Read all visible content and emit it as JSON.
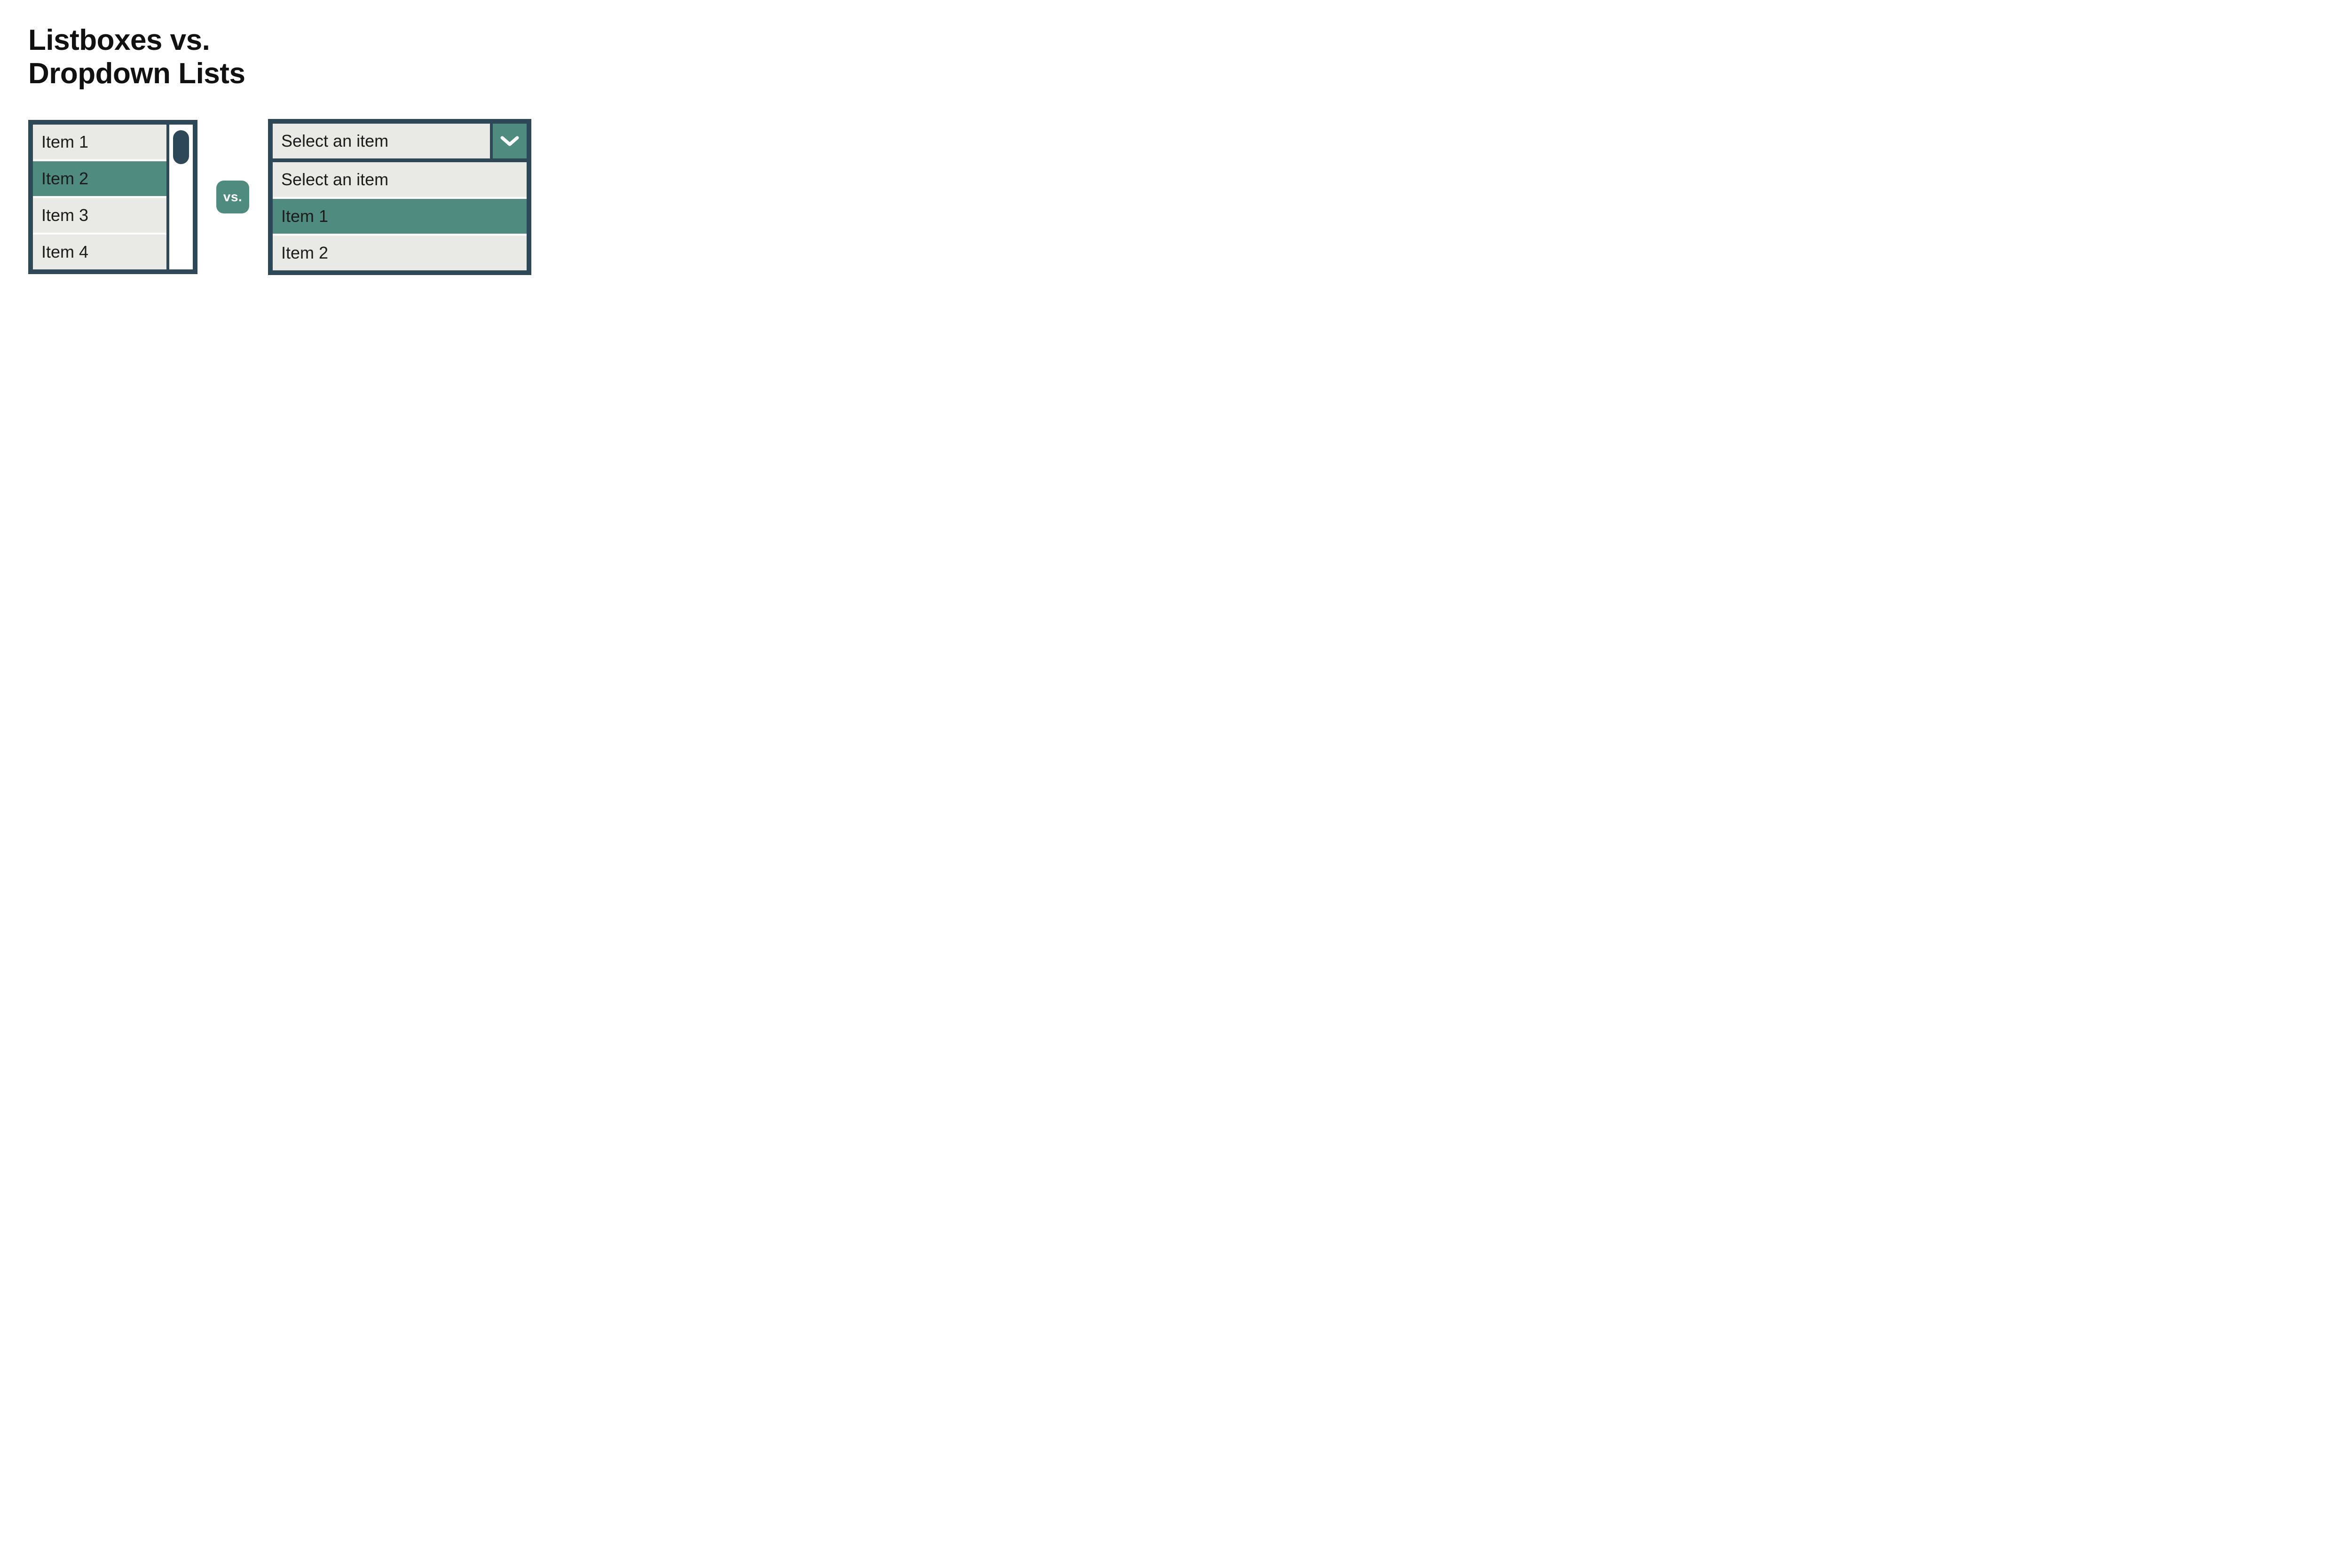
{
  "title_line1": "Listboxes vs.",
  "title_line2": "Dropdown Lists",
  "vs_label": "vs.",
  "listbox": {
    "items": [
      {
        "label": "Item 1",
        "selected": false
      },
      {
        "label": "Item 2",
        "selected": true
      },
      {
        "label": "Item 3",
        "selected": false
      },
      {
        "label": "Item 4",
        "selected": false
      }
    ]
  },
  "dropdown": {
    "trigger_label": "Select an item",
    "items": [
      {
        "label": "Select an item",
        "selected": false
      },
      {
        "label": "Item 1",
        "selected": true
      },
      {
        "label": "Item 2",
        "selected": false
      }
    ]
  },
  "colors": {
    "border": "#2F4858",
    "accent": "#508B80",
    "item_bg": "#E9E9E6",
    "text": "#111111"
  }
}
